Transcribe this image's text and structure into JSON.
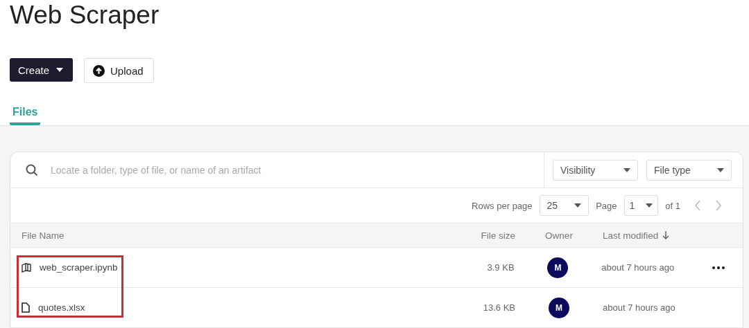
{
  "page_title": "Web Scraper",
  "actions": [
    {
      "kind": "dropdown",
      "label": "Create"
    },
    {
      "kind": "upload",
      "label": "Upload"
    }
  ],
  "tabs": [
    {
      "label": "Files",
      "selected": true
    }
  ],
  "search": {
    "placeholder": "Locate a folder, type of file, or name of an artifact"
  },
  "filters": [
    {
      "label": "Visibility"
    },
    {
      "label": "File type"
    }
  ],
  "pagination": {
    "rows_label": "Rows per page",
    "rows_value": "25",
    "page_label": "Page",
    "page_value": "1",
    "of_label": "of 1"
  },
  "table": {
    "columns": [
      {
        "label": "File Name",
        "sorted": false
      },
      {
        "label": "File size",
        "sorted": false
      },
      {
        "label": "Owner",
        "sorted": false
      },
      {
        "label": "Last modified",
        "sorted": true
      }
    ],
    "rows": [
      {
        "kind": "notebook",
        "name": "web_scraper.ipynb",
        "size": "3.9 KB",
        "owner": "M",
        "modified": "about 7 hours ago",
        "actions_visible": true
      },
      {
        "kind": "file",
        "name": "quotes.xlsx",
        "size": "13.6 KB",
        "owner": "M",
        "modified": "about 7 hours ago",
        "actions_visible": false
      }
    ],
    "file_names_highlighted": true
  }
}
